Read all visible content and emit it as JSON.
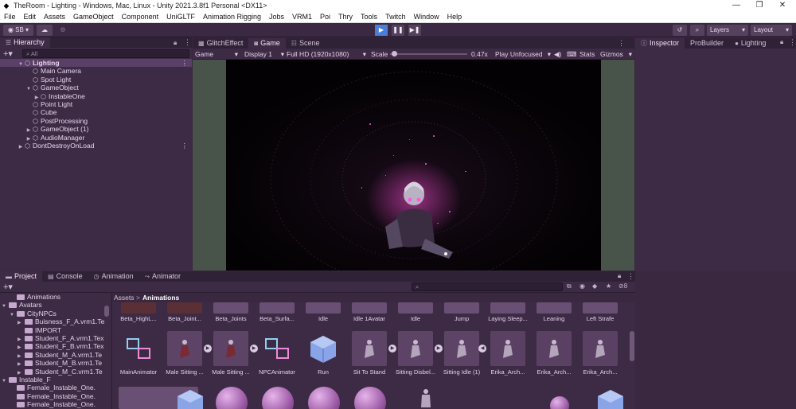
{
  "window": {
    "title": "TheRoom - Lighting - Windows, Mac, Linux - Unity 2021.3.8f1 Personal <DX11>",
    "controls": [
      "—",
      "❐",
      "✕"
    ]
  },
  "menu": [
    "File",
    "Edit",
    "Assets",
    "GameObject",
    "Component",
    "UniGLTF",
    "Animation Rigging",
    "Jobs",
    "VRM1",
    "Poi",
    "Thry",
    "Tools",
    "Twitch",
    "Window",
    "Help"
  ],
  "toolbar": {
    "account": "SB",
    "layers_label": "Layers",
    "layout_label": "Layout"
  },
  "hierarchy": {
    "tab": "Hierarchy",
    "search_placeholder": "All",
    "rows": [
      {
        "label": "Lighting",
        "indent": 0,
        "arrow": "▼"
      },
      {
        "label": "Main Camera",
        "indent": 1,
        "arrow": ""
      },
      {
        "label": "Spot Light",
        "indent": 1,
        "arrow": ""
      },
      {
        "label": "GameObject",
        "indent": 1,
        "arrow": "▼"
      },
      {
        "label": "InstableOne",
        "indent": 2,
        "arrow": "▶"
      },
      {
        "label": "Point Light",
        "indent": 1,
        "arrow": ""
      },
      {
        "label": "Cube",
        "indent": 1,
        "arrow": ""
      },
      {
        "label": "PostProcessing",
        "indent": 1,
        "arrow": ""
      },
      {
        "label": "GameObject (1)",
        "indent": 1,
        "arrow": "▶"
      },
      {
        "label": "AudioManager",
        "indent": 1,
        "arrow": "▶"
      },
      {
        "label": "DontDestroyOnLoad",
        "indent": 0,
        "arrow": "▶"
      }
    ]
  },
  "center_tabs": [
    "GlitchEffect",
    "Game",
    "Scene"
  ],
  "game_bar": {
    "mode": "Game",
    "display": "Display 1",
    "resolution": "Full HD (1920x1080)",
    "scale_label": "Scale",
    "scale_value": "0.47x",
    "play_mode": "Play Unfocused",
    "stats": "Stats",
    "gizmos": "Gizmos",
    "scale_fraction": 0.05
  },
  "right_tabs": [
    "Inspector",
    "ProBuilder",
    "Lighting"
  ],
  "bottom_tabs": [
    "Project",
    "Console",
    "Animation",
    "Animator"
  ],
  "project": {
    "hidden_count": "8",
    "tree": [
      {
        "label": "Animations",
        "indent": 1,
        "arrow": ""
      },
      {
        "label": "Avatars",
        "indent": 0,
        "arrow": "▼"
      },
      {
        "label": "CityNPCs",
        "indent": 1,
        "arrow": "▼"
      },
      {
        "label": "Buisness_F_A.vrm1.Te",
        "indent": 2,
        "arrow": "▶"
      },
      {
        "label": "IMPORT",
        "indent": 2,
        "arrow": ""
      },
      {
        "label": "Student_F_A.vrm1.Tex",
        "indent": 2,
        "arrow": "▶"
      },
      {
        "label": "Student_F_B.vrm1.Tex",
        "indent": 2,
        "arrow": "▶"
      },
      {
        "label": "Student_M_A.vrm1.Te",
        "indent": 2,
        "arrow": "▶"
      },
      {
        "label": "Student_M_B.vrm1.Te",
        "indent": 2,
        "arrow": "▶"
      },
      {
        "label": "Student_M_C.vrm1.Te",
        "indent": 2,
        "arrow": "▶"
      },
      {
        "label": "Instable_F",
        "indent": 0,
        "arrow": "▼"
      },
      {
        "label": "Female_Instable_One.",
        "indent": 1,
        "arrow": ""
      },
      {
        "label": "Female_Instable_One.",
        "indent": 1,
        "arrow": ""
      },
      {
        "label": "Female_Instable_One.",
        "indent": 1,
        "arrow": ""
      }
    ],
    "breadcrumb": [
      "Assets",
      "Animations"
    ],
    "row1": [
      "Beta_HighL...",
      "Beta_Joint...",
      "Beta_Joints",
      "Beta_Surfa...",
      "Idle",
      "Idle 1Avatar",
      "Idle",
      "Jump",
      "Laying Sleep...",
      "Leaning",
      "Left Strafe"
    ],
    "row2": [
      "MainAnimator",
      "Male Sitting ...",
      "Male Sitting ...",
      "NPCAnimator",
      "Run",
      "Sit To Stand",
      "Sitting Disbel...",
      "Sitting Idle (1)",
      "Erika_Arch...",
      "Erika_Arch...",
      "Erika_Arch..."
    ]
  },
  "colors": {
    "accent": "#4a7ed8",
    "panel": "#3d2b45",
    "glow": "#ff4fd8"
  }
}
